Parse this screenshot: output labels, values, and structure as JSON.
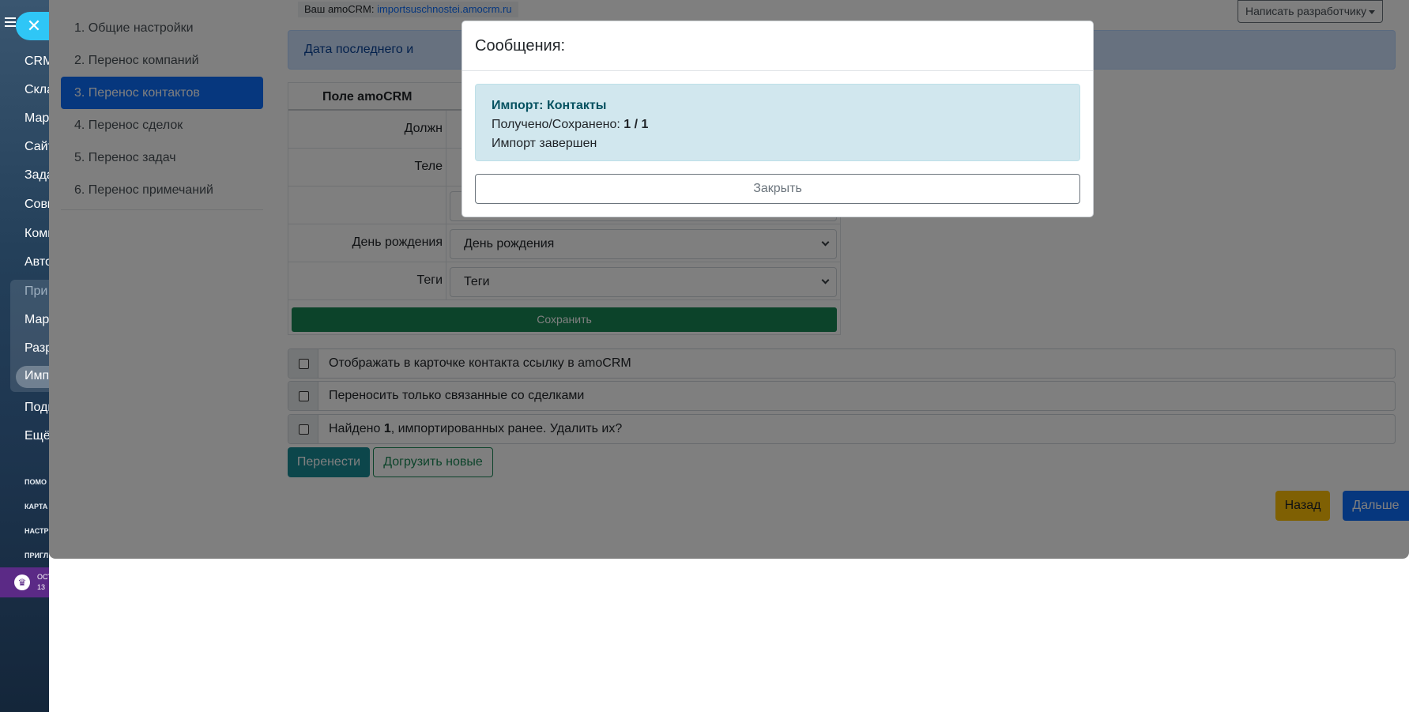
{
  "sidebar": {
    "items": [
      {
        "label": "CRM"
      },
      {
        "label": "Скла"
      },
      {
        "label": "Мар"
      },
      {
        "label": "Сайт"
      },
      {
        "label": "Зада"
      },
      {
        "label": "Совм"
      },
      {
        "label": "Комп"
      },
      {
        "label": "Авто"
      },
      {
        "label": "При"
      },
      {
        "label": "Мар"
      },
      {
        "label": "Разр"
      },
      {
        "label": "Имп"
      },
      {
        "label": "Подп"
      },
      {
        "label": "Ещё"
      }
    ],
    "small_items": [
      {
        "label": "ПОМО"
      },
      {
        "label": "КАРТА"
      },
      {
        "label": "НАСТР"
      },
      {
        "label": "ПРИГЛ"
      }
    ],
    "promo": {
      "line1": "ОСТ",
      "line2": "13"
    }
  },
  "steps": {
    "items": [
      {
        "label": "1. Общие настройки"
      },
      {
        "label": "2. Перенос компаний"
      },
      {
        "label": "3. Перенос контактов"
      },
      {
        "label": "4. Перенос сделок"
      },
      {
        "label": "5. Перенос задач"
      },
      {
        "label": "6. Перенос примечаний"
      }
    ],
    "active_index": 2
  },
  "header": {
    "amo_prefix": "Ваш amoCRM:",
    "amo_domain": "importsuschnostei.amocrm.ru",
    "dev_button": "Написать разработчику"
  },
  "alert": {
    "text": "Дата последнего и"
  },
  "mapping": {
    "header": "Поле amoCRM",
    "rows": [
      {
        "label": "Должн",
        "value": ""
      },
      {
        "label": "Теле",
        "value": ""
      },
      {
        "label": "",
        "value": ""
      },
      {
        "label": "День рождения",
        "value": "День рождения"
      },
      {
        "label": "Теги",
        "value": "Теги"
      }
    ],
    "save_label": "Сохранить"
  },
  "options": [
    {
      "text": "Отображать в карточке контакта ссылку в amoCRM",
      "checked": false
    },
    {
      "text": "Переносить только связанные со сделками",
      "checked": false
    },
    {
      "text_before": "Найдено ",
      "count": "1",
      "text_after": ", импортированных ранее. Удалить их?",
      "checked": false
    }
  ],
  "actions": {
    "transfer": "Перенести",
    "load_new": "Догрузить новые",
    "back": "Назад",
    "next": "Дальше"
  },
  "modal": {
    "title": "Сообщения:",
    "alert_title": "Импорт: Контакты",
    "received_label": "Получено/Сохранено: ",
    "received_value": "1 / 1",
    "status": "Импорт завершен",
    "close": "Закрыть"
  },
  "colors": {
    "primary": "#0d6efd",
    "success": "#198754",
    "warning": "#ffc107",
    "info": "#198c97",
    "sidebar_accent": "#2fc6f6"
  }
}
